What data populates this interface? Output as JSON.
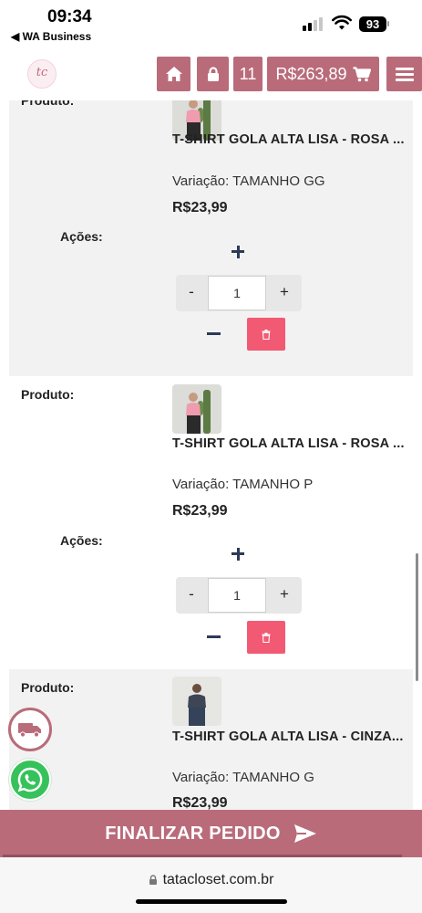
{
  "status_bar": {
    "time": "09:34",
    "back_app": "◀ WA Business",
    "battery": "93"
  },
  "header": {
    "logo_text": "tc",
    "home_icon": "home-icon",
    "lock_icon": "lock-icon",
    "cart_count": "11",
    "cart_total": "R$263,89",
    "cart_icon": "cart-icon",
    "menu_icon": "hamburger-icon",
    "brand_color": "#b96b7a"
  },
  "labels": {
    "produto": "Produto:",
    "acoes": "Ações:"
  },
  "items": [
    {
      "name": "T-SHIRT GOLA ALTA LISA - ROSA ...",
      "variation": "Variação: TAMANHO GG",
      "price": "R$23,99",
      "quantity": "1",
      "minus": "-",
      "plus": "+"
    },
    {
      "name": "T-SHIRT GOLA ALTA LISA - ROSA ...",
      "variation": "Variação: TAMANHO P",
      "price": "R$23,99",
      "quantity": "1",
      "minus": "-",
      "plus": "+"
    },
    {
      "name": "T-SHIRT GOLA ALTA LISA - CINZA...",
      "variation": "Variação: TAMANHO G",
      "price": "R$23,99"
    }
  ],
  "checkout": {
    "label": "FINALIZAR PEDIDO",
    "icon": "send-icon"
  },
  "browser": {
    "url": "tatacloset.com.br"
  },
  "colors": {
    "delete": "#f25a74",
    "accent_dark": "#2b3b57",
    "whatsapp": "#36c25a"
  }
}
